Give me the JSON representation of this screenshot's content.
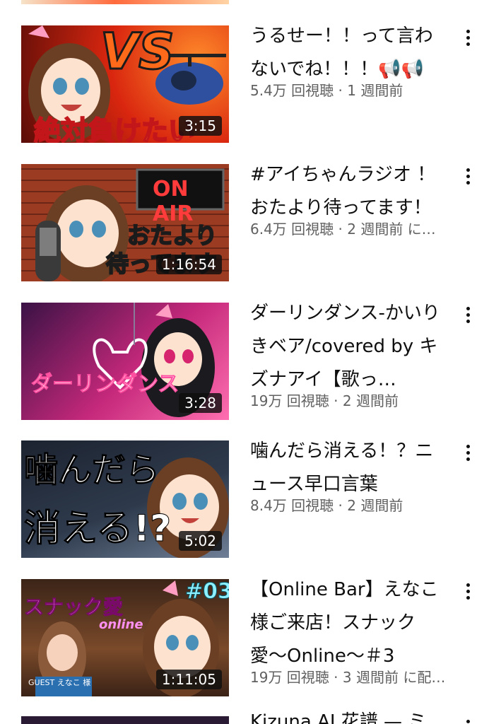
{
  "feed": {
    "videos": [
      {
        "title": "うるせー！！って言わないでね！！！📢📢",
        "views": "5.4万 回視聴",
        "age": "1 週間前",
        "meta": "5.4万 回視聴 · 1 週間前",
        "duration": "3:15",
        "thumb_text_1": "VS",
        "thumb_text_2": "絶対負けたい"
      },
      {
        "title": "#アイちゃんラジオ ！おたより待ってます！",
        "meta": "6.4万 回視聴 · 2 週間前 に…",
        "duration": "1:16:54",
        "thumb_text_1": "ON AIR",
        "thumb_text_2": "おたより",
        "thumb_text_3": "待ってます"
      },
      {
        "title": "ダーリンダンス-かいりきベア/covered by キズナアイ【歌っ…",
        "meta": "19万 回視聴 · 2 週間前",
        "duration": "3:28",
        "thumb_text_1": "ダーリンダンス"
      },
      {
        "title": "噛んだら消える！？ニュース早口言葉",
        "meta": "8.4万 回視聴 · 2 週間前",
        "duration": "5:02",
        "thumb_text_1": "噛んだら",
        "thumb_text_2": "消える!?"
      },
      {
        "title": "【Online Bar】えなこ様ご来店！スナック愛〜Online〜＃3",
        "meta": "19万 回視聴 · 3 週間前 に配…",
        "duration": "1:11:05",
        "thumb_text_1": "#03",
        "thumb_text_2": "スナック愛",
        "thumb_text_3": "online",
        "thumb_text_4": "GUEST えなこ 様"
      }
    ],
    "partial_next_title": "Kizuna AI 花譜 — ミ"
  },
  "colors": {
    "text_primary": "#0f0f0f",
    "text_secondary": "#606060",
    "duration_bg": "#0f0f0f"
  },
  "icons": {
    "more": "three-dot-vertical-icon",
    "megaphone": "megaphone-emoji"
  }
}
